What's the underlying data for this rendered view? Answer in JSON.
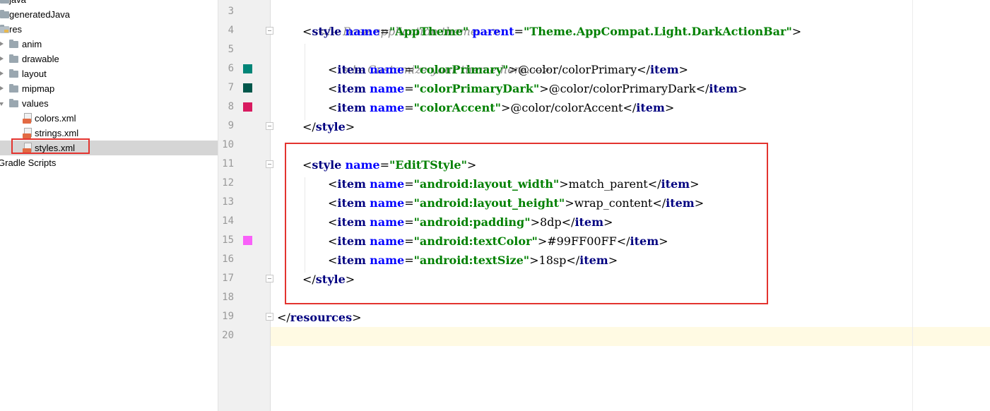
{
  "project_tree": {
    "items": [
      {
        "label": "java",
        "type": "folder-src"
      },
      {
        "label": "generatedJava",
        "type": "folder-src"
      },
      {
        "label": "res",
        "type": "folder-res"
      },
      {
        "label": "anim",
        "type": "folder"
      },
      {
        "label": "drawable",
        "type": "folder"
      },
      {
        "label": "layout",
        "type": "folder"
      },
      {
        "label": "mipmap",
        "type": "folder"
      },
      {
        "label": "values",
        "type": "folder"
      },
      {
        "label": "colors.xml",
        "type": "xml-file"
      },
      {
        "label": "strings.xml",
        "type": "xml-file"
      },
      {
        "label": "styles.xml",
        "type": "xml-file",
        "selected": true
      },
      {
        "label": "Gradle Scripts",
        "type": "group"
      }
    ]
  },
  "editor": {
    "line_numbers": [
      "3",
      "4",
      "5",
      "6",
      "7",
      "8",
      "9",
      "10",
      "11",
      "12",
      "13",
      "14",
      "15",
      "16",
      "17",
      "18",
      "19",
      "20"
    ],
    "current_line": "20",
    "color_swatches": [
      {
        "line": "6",
        "color": "#008577"
      },
      {
        "line": "7",
        "color": "#00574B"
      },
      {
        "line": "8",
        "color": "#D81B60"
      },
      {
        "line": "15",
        "color": "#FF00FF",
        "alpha": 0.6
      }
    ],
    "code": {
      "l3": "<!-- Base application theme. -->",
      "l4_tag": "style",
      "l4_attr1": "name",
      "l4_val1": "\"AppTheme\"",
      "l4_attr2": "parent",
      "l4_val2": "\"Theme.AppCompat.Light.DarkActionBar\"",
      "l5": "<!-- Customize your theme here. -->",
      "item": "item",
      "name": "name",
      "style": "style",
      "l6_val": "\"colorPrimary\"",
      "l6_text": "@color/colorPrimary",
      "l7_val": "\"colorPrimaryDark\"",
      "l7_text": "@color/colorPrimaryDark",
      "l8_val": "\"colorAccent\"",
      "l8_text": "@color/colorAccent",
      "l11_val": "\"EditTStyle\"",
      "l12_val": "\"android:layout_width\"",
      "l12_text": "match_parent",
      "l13_val": "\"android:layout_height\"",
      "l13_text": "wrap_content",
      "l14_val": "\"android:padding\"",
      "l14_text": "8dp",
      "l15_val": "\"android:textColor\"",
      "l15_text": "#99FF00FF",
      "l16_val": "\"android:textSize\"",
      "l16_text": "18sp",
      "l19_tag": "resources"
    }
  },
  "colors": {
    "highlight_border": "#e3342f",
    "tag": "#000080",
    "attribute": "#0000ff",
    "value": "#008000",
    "comment": "#8c8c8c"
  }
}
